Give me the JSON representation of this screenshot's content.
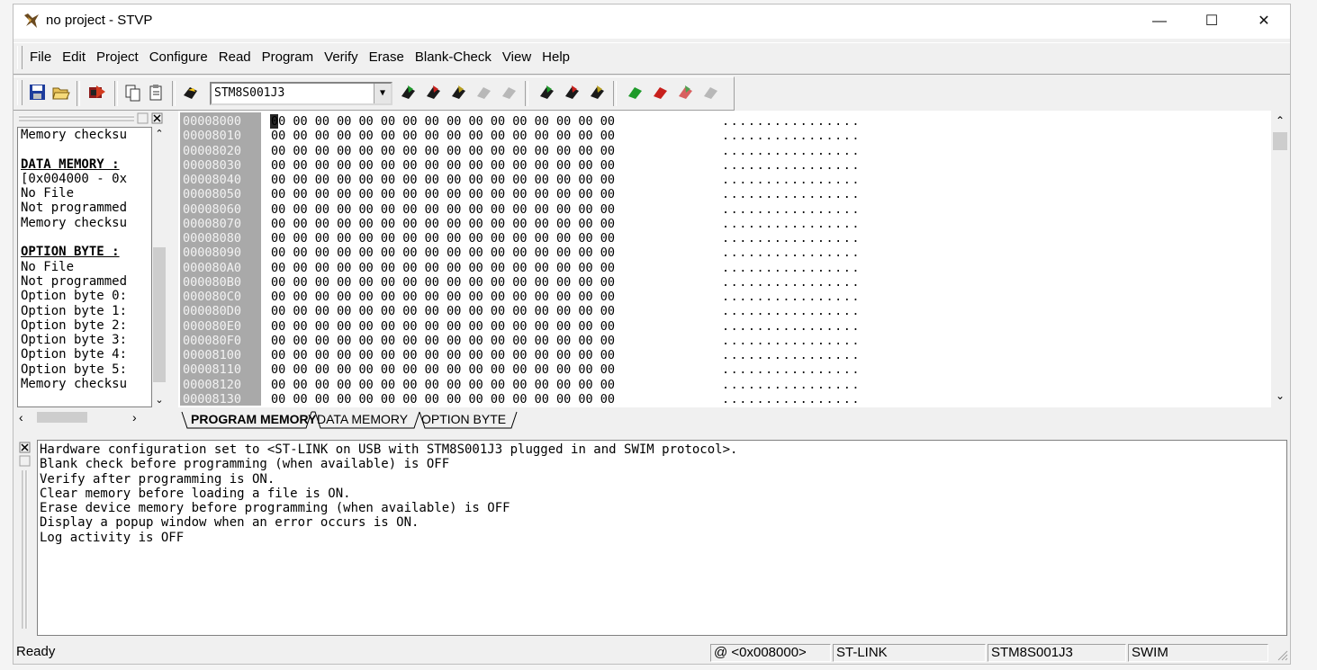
{
  "window": {
    "title": "no project - STVP",
    "minimize": "—",
    "maximize": "☐",
    "close": "✕"
  },
  "menu": [
    "File",
    "Edit",
    "Project",
    "Configure",
    "Read",
    "Program",
    "Verify",
    "Erase",
    "Blank-Check",
    "View",
    "Help"
  ],
  "toolbar": {
    "device": "STM8S001J3",
    "icons": [
      "save-icon",
      "open-icon",
      "read-all-icon",
      "copy-icon",
      "paste-icon",
      "config-icon",
      "read-icon",
      "write-icon",
      "verify-icon",
      "erase-icon",
      "blank-check-icon"
    ]
  },
  "info_panel": {
    "lines": [
      {
        "text": "Memory checksu",
        "bold": false
      },
      {
        "text": "",
        "bold": false
      },
      {
        "text": "DATA MEMORY :",
        "bold": true
      },
      {
        "text": "[0x004000 - 0x",
        "bold": false
      },
      {
        "text": "No File",
        "bold": false
      },
      {
        "text": "Not programmed",
        "bold": false
      },
      {
        "text": "Memory checksu",
        "bold": false
      },
      {
        "text": "",
        "bold": false
      },
      {
        "text": "OPTION BYTE :",
        "bold": true
      },
      {
        "text": "No File",
        "bold": false
      },
      {
        "text": "Not programmed",
        "bold": false
      },
      {
        "text": "Option byte 0:",
        "bold": false
      },
      {
        "text": "Option byte 1:",
        "bold": false
      },
      {
        "text": "Option byte 2:",
        "bold": false
      },
      {
        "text": "Option byte 3:",
        "bold": false
      },
      {
        "text": "Option byte 4:",
        "bold": false
      },
      {
        "text": "Option byte 5:",
        "bold": false
      },
      {
        "text": "Memory checksu",
        "bold": false
      }
    ]
  },
  "hex": {
    "addresses": [
      "00008000",
      "00008010",
      "00008020",
      "00008030",
      "00008040",
      "00008050",
      "00008060",
      "00008070",
      "00008080",
      "00008090",
      "000080A0",
      "000080B0",
      "000080C0",
      "000080D0",
      "000080E0",
      "000080F0",
      "00008100",
      "00008110",
      "00008120",
      "00008130"
    ],
    "bytes": "00 00 00 00 00 00 00 00 00 00 00 00 00 00 00 00",
    "ascii": "................"
  },
  "tabs": [
    "PROGRAM MEMORY",
    "DATA MEMORY",
    "OPTION BYTE"
  ],
  "log": [
    "Hardware configuration set to <ST-LINK on USB with STM8S001J3 plugged in and SWIM protocol>.",
    "Blank check before programming (when available) is OFF",
    "Verify after programming is ON.",
    "Clear memory before loading a file is ON.",
    "Erase device memory before programming (when available) is OFF",
    "Display a popup window when an error occurs is ON.",
    "Log activity is OFF"
  ],
  "status": {
    "ready": "Ready",
    "address": "@ <0x008000>",
    "tool": "ST-LINK",
    "device": "STM8S001J3",
    "protocol": "SWIM"
  }
}
